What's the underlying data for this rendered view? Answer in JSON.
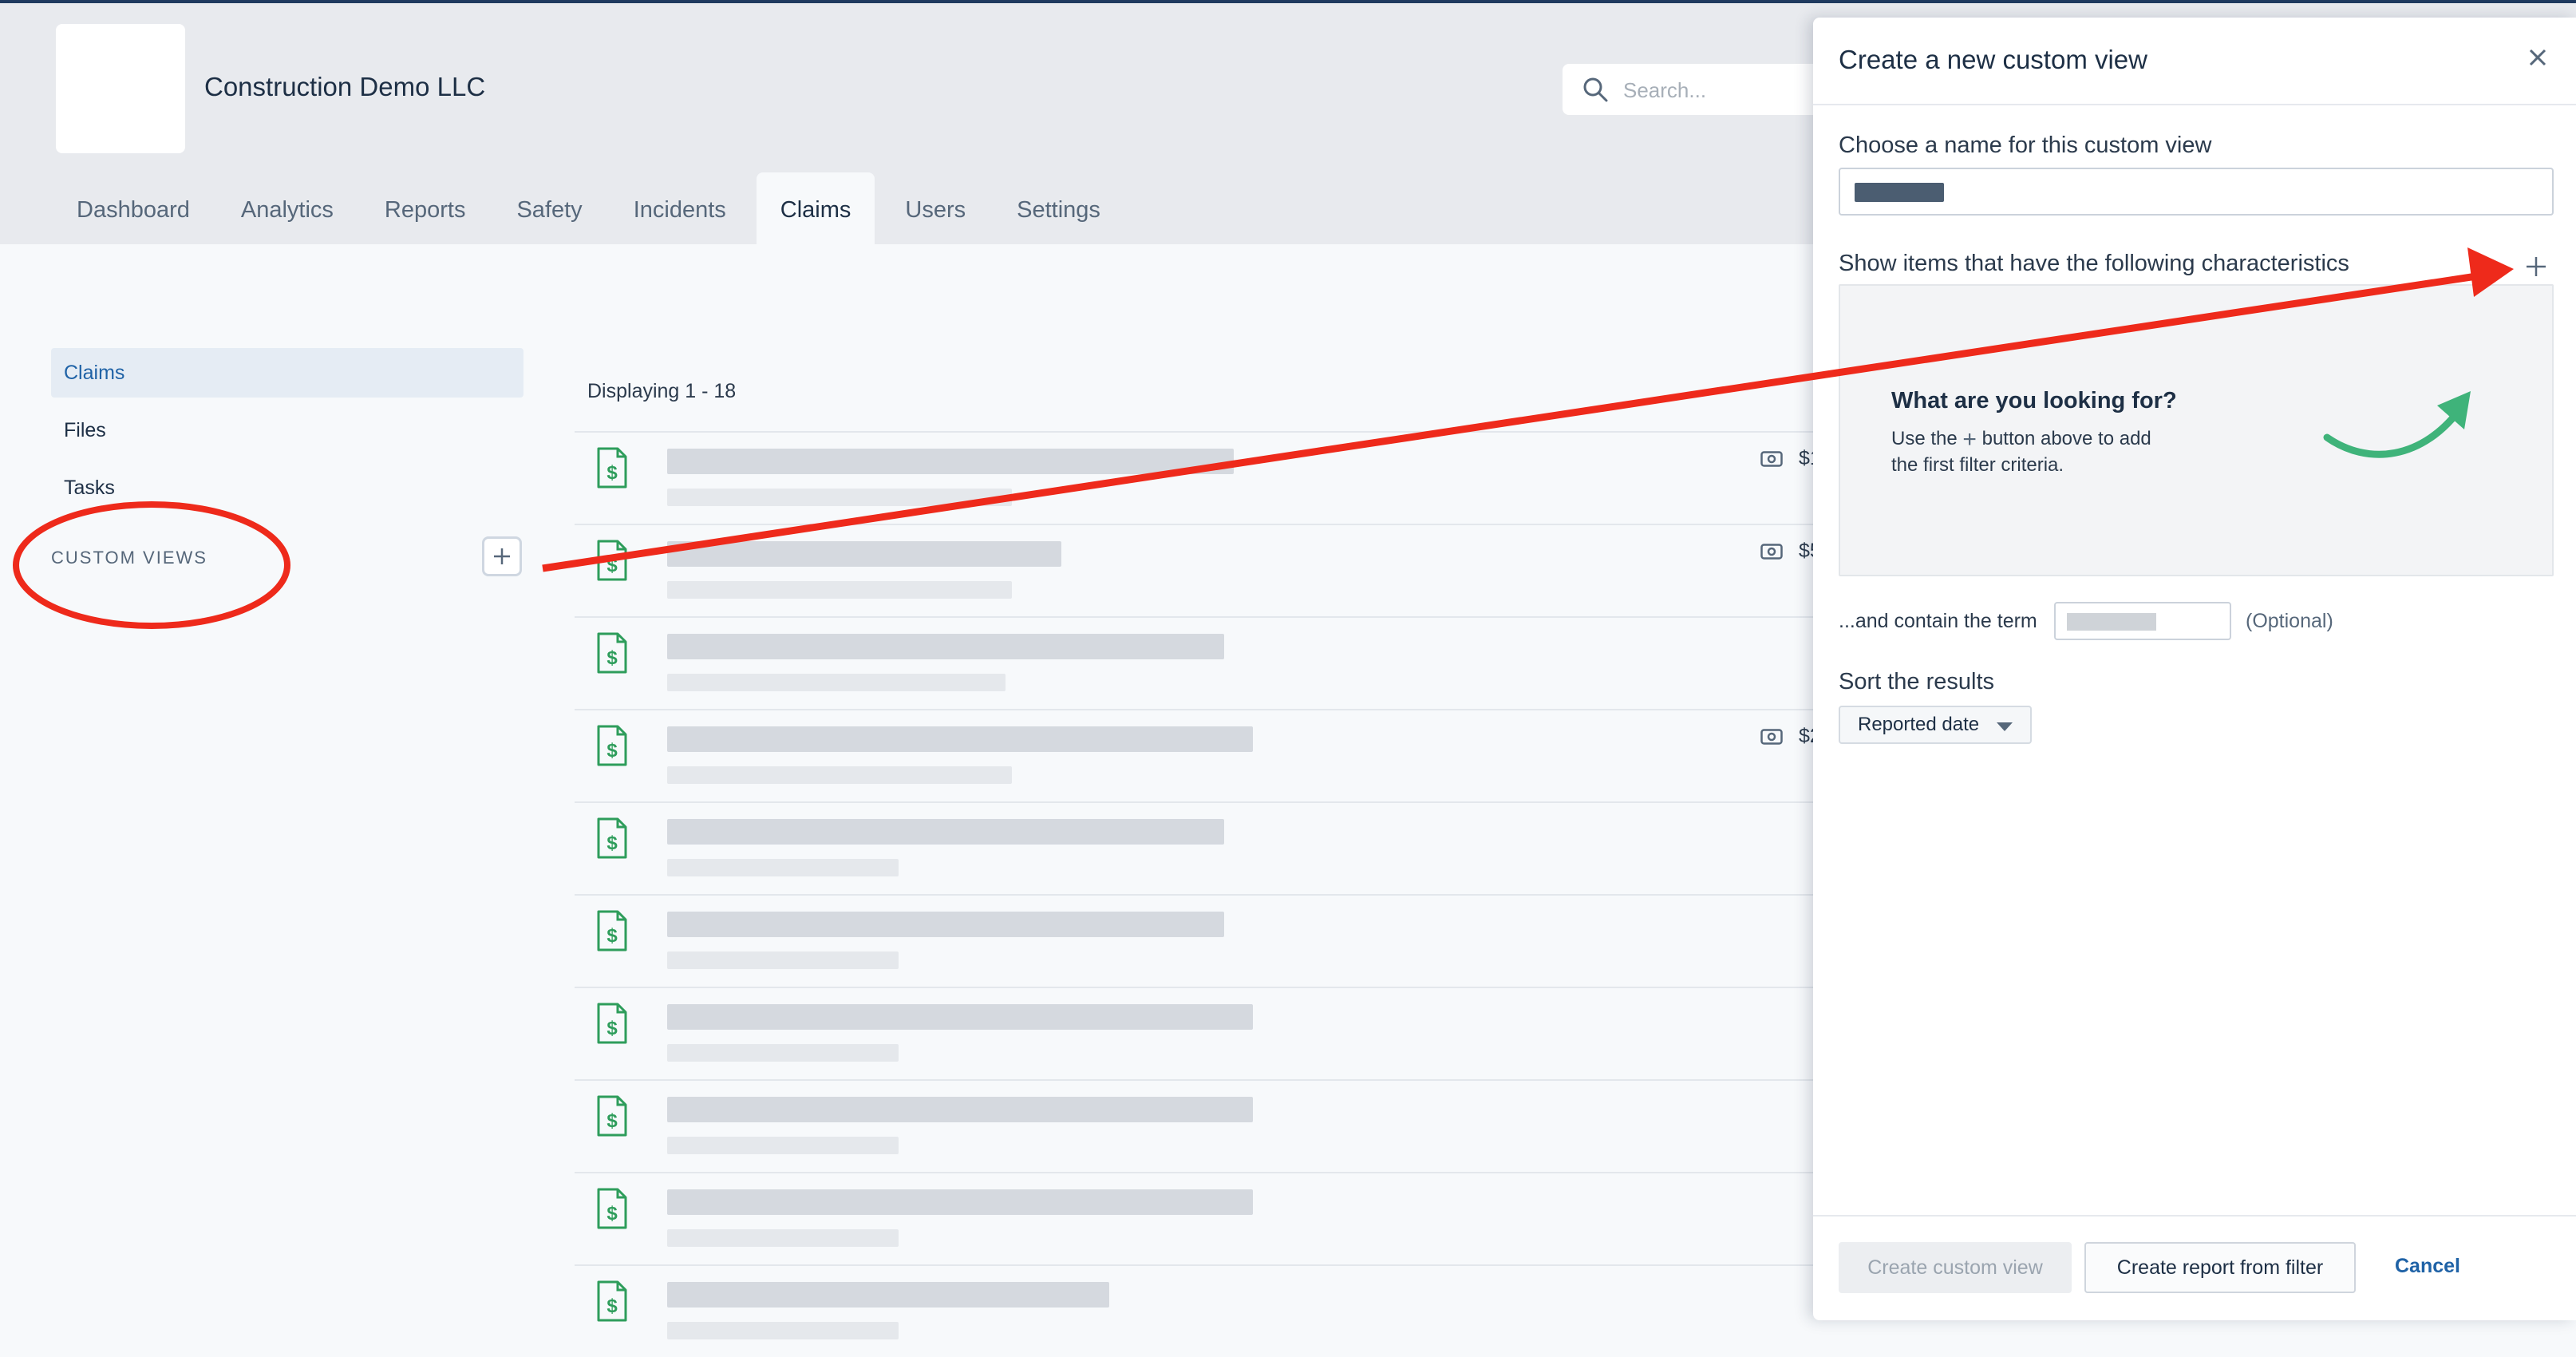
{
  "header": {
    "company_name": "Construction Demo LLC",
    "search_placeholder": "Search...",
    "nav_tabs": [
      "Dashboard",
      "Analytics",
      "Reports",
      "Safety",
      "Incidents",
      "Claims",
      "Users",
      "Settings"
    ],
    "active_tab": "Claims"
  },
  "sidebar": {
    "items": [
      "Claims",
      "Files",
      "Tasks"
    ],
    "custom_views_label": "CUSTOM VIEWS"
  },
  "main": {
    "displaying": "Displaying 1 - 18",
    "amounts": [
      "$1,",
      "$5,",
      "$2,"
    ]
  },
  "panel": {
    "title": "Create a new custom view",
    "name_label": "Choose a name for this custom view",
    "characteristics_label": "Show items that have the following characteristics",
    "empty_title": "What are you looking for?",
    "empty_desc_prefix": "Use the",
    "empty_desc_suffix": "button above to add the first filter criteria.",
    "term_label": "...and contain the term",
    "term_optional": "(Optional)",
    "sort_label": "Sort the results",
    "sort_value": "Reported date",
    "create_button": "Create custom view",
    "report_button": "Create report from filter",
    "cancel_button": "Cancel"
  },
  "colors": {
    "annotation_red": "#ee2a1b",
    "icon_green": "#2e9d5b",
    "arrow_green": "#3fb37a",
    "link_blue": "#1f62a6"
  },
  "icons": [
    "search-icon",
    "plus-icon",
    "document-dollar-icon",
    "money-icon",
    "close-icon",
    "curved-arrow-icon"
  ]
}
